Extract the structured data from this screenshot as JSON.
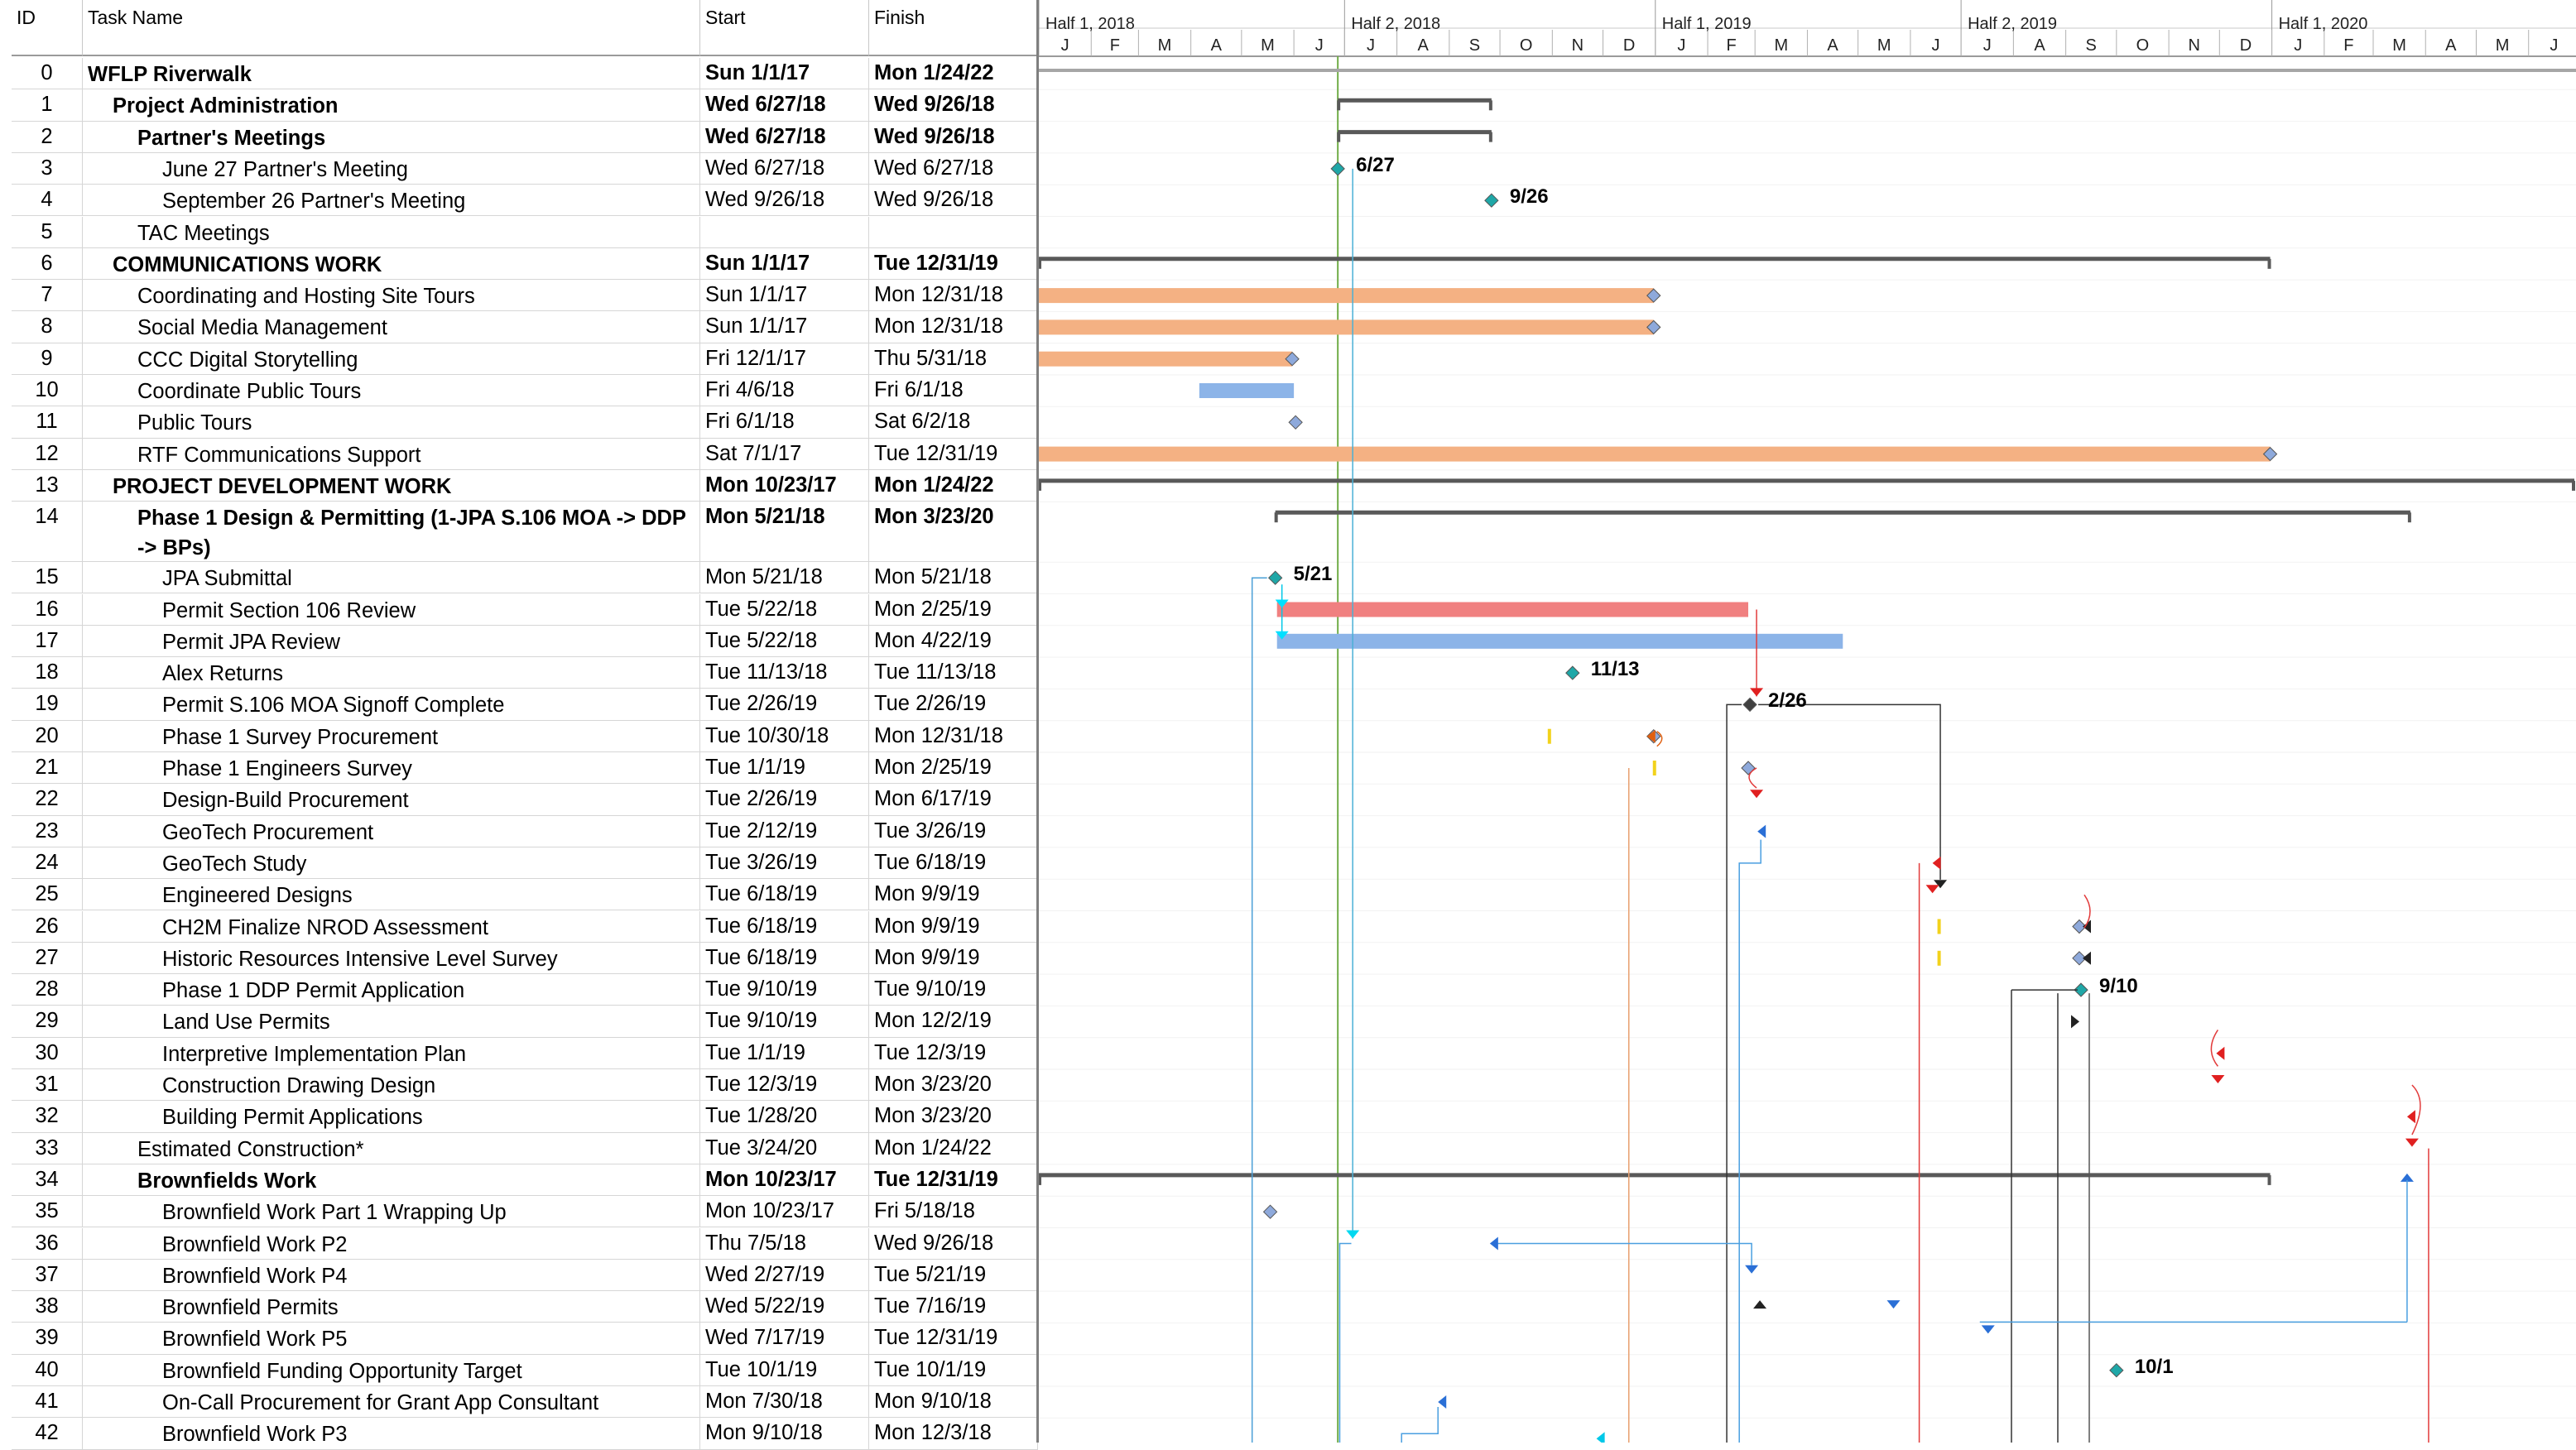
{
  "columns": {
    "id": "ID",
    "name": "Task Name",
    "start": "Start",
    "finish": "Finish"
  },
  "timescale": {
    "halves": [
      "Half 1, 2018",
      "Half 2, 2018",
      "Half 1, 2019",
      "Half 2, 2019",
      "Half 1, 2020"
    ],
    "months": [
      "J",
      "F",
      "M",
      "A",
      "M",
      "J",
      "J",
      "A",
      "S",
      "O",
      "N",
      "D",
      "J",
      "F",
      "M",
      "A",
      "M",
      "J",
      "J",
      "A",
      "S",
      "O",
      "N",
      "D",
      "J",
      "F",
      "M",
      "A",
      "M",
      "J"
    ]
  },
  "tasks": [
    {
      "id": "0",
      "name": "WFLP Riverwalk",
      "start": "Sun 1/1/17",
      "finish": "Mon 1/24/22",
      "bold": true,
      "indent": 0
    },
    {
      "id": "1",
      "name": "Project Administration",
      "start": "Wed 6/27/18",
      "finish": "Wed 9/26/18",
      "bold": true,
      "indent": 1
    },
    {
      "id": "2",
      "name": "Partner's Meetings",
      "start": "Wed 6/27/18",
      "finish": "Wed 9/26/18",
      "bold": true,
      "indent": 2
    },
    {
      "id": "3",
      "name": "June 27 Partner's Meeting",
      "start": "Wed 6/27/18",
      "finish": "Wed 6/27/18",
      "bold": false,
      "indent": 3
    },
    {
      "id": "4",
      "name": "September 26 Partner's Meeting",
      "start": "Wed 9/26/18",
      "finish": "Wed 9/26/18",
      "bold": false,
      "indent": 3
    },
    {
      "id": "5",
      "name": "TAC Meetings",
      "start": "",
      "finish": "",
      "bold": false,
      "indent": 2
    },
    {
      "id": "6",
      "name": "COMMUNICATIONS WORK",
      "start": "Sun 1/1/17",
      "finish": "Tue 12/31/19",
      "bold": true,
      "indent": 1
    },
    {
      "id": "7",
      "name": "Coordinating and Hosting Site Tours",
      "start": "Sun 1/1/17",
      "finish": "Mon 12/31/18",
      "bold": false,
      "indent": 2
    },
    {
      "id": "8",
      "name": "Social Media Management",
      "start": "Sun 1/1/17",
      "finish": "Mon 12/31/18",
      "bold": false,
      "indent": 2
    },
    {
      "id": "9",
      "name": "CCC Digital Storytelling",
      "start": "Fri 12/1/17",
      "finish": "Thu 5/31/18",
      "bold": false,
      "indent": 2
    },
    {
      "id": "10",
      "name": "Coordinate Public Tours",
      "start": "Fri 4/6/18",
      "finish": "Fri 6/1/18",
      "bold": false,
      "indent": 2
    },
    {
      "id": "11",
      "name": "Public Tours",
      "start": "Fri 6/1/18",
      "finish": "Sat 6/2/18",
      "bold": false,
      "indent": 2
    },
    {
      "id": "12",
      "name": "RTF Communications Support",
      "start": "Sat 7/1/17",
      "finish": "Tue 12/31/19",
      "bold": false,
      "indent": 2
    },
    {
      "id": "13",
      "name": "PROJECT DEVELOPMENT WORK",
      "start": "Mon 10/23/17",
      "finish": "Mon 1/24/22",
      "bold": true,
      "indent": 1
    },
    {
      "id": "14",
      "name": "Phase 1 Design & Permitting (1-JPA S.106 MOA -> DDP -> BPs)",
      "start": "Mon 5/21/18",
      "finish": "Mon 3/23/20",
      "bold": true,
      "indent": 2,
      "tall": true
    },
    {
      "id": "15",
      "name": "JPA Submittal",
      "start": "Mon 5/21/18",
      "finish": "Mon 5/21/18",
      "bold": false,
      "indent": 3
    },
    {
      "id": "16",
      "name": "Permit Section 106 Review",
      "start": "Tue 5/22/18",
      "finish": "Mon 2/25/19",
      "bold": false,
      "indent": 3
    },
    {
      "id": "17",
      "name": "Permit JPA Review",
      "start": "Tue 5/22/18",
      "finish": "Mon 4/22/19",
      "bold": false,
      "indent": 3
    },
    {
      "id": "18",
      "name": "Alex Returns",
      "start": "Tue 11/13/18",
      "finish": "Tue 11/13/18",
      "bold": false,
      "indent": 3
    },
    {
      "id": "19",
      "name": "Permit S.106 MOA Signoff Complete",
      "start": "Tue 2/26/19",
      "finish": "Tue 2/26/19",
      "bold": false,
      "indent": 3
    },
    {
      "id": "20",
      "name": "Phase 1 Survey Procurement",
      "start": "Tue 10/30/18",
      "finish": "Mon 12/31/18",
      "bold": false,
      "indent": 3
    },
    {
      "id": "21",
      "name": "Phase 1 Engineers Survey",
      "start": "Tue 1/1/19",
      "finish": "Mon 2/25/19",
      "bold": false,
      "indent": 3
    },
    {
      "id": "22",
      "name": "Design-Build Procurement",
      "start": "Tue 2/26/19",
      "finish": "Mon 6/17/19",
      "bold": false,
      "indent": 3
    },
    {
      "id": "23",
      "name": "GeoTech Procurement",
      "start": "Tue 2/12/19",
      "finish": "Tue 3/26/19",
      "bold": false,
      "indent": 3
    },
    {
      "id": "24",
      "name": "GeoTech Study",
      "start": "Tue 3/26/19",
      "finish": "Tue 6/18/19",
      "bold": false,
      "indent": 3
    },
    {
      "id": "25",
      "name": "Engineered Designs",
      "start": "Tue 6/18/19",
      "finish": "Mon 9/9/19",
      "bold": false,
      "indent": 3
    },
    {
      "id": "26",
      "name": "CH2M Finalize NROD Assessment",
      "start": "Tue 6/18/19",
      "finish": "Mon 9/9/19",
      "bold": false,
      "indent": 3
    },
    {
      "id": "27",
      "name": "Historic Resources Intensive Level Survey",
      "start": "Tue 6/18/19",
      "finish": "Mon 9/9/19",
      "bold": false,
      "indent": 3
    },
    {
      "id": "28",
      "name": "Phase 1 DDP Permit Application",
      "start": "Tue 9/10/19",
      "finish": "Tue 9/10/19",
      "bold": false,
      "indent": 3
    },
    {
      "id": "29",
      "name": "Land Use Permits",
      "start": "Tue 9/10/19",
      "finish": "Mon 12/2/19",
      "bold": false,
      "indent": 3
    },
    {
      "id": "30",
      "name": "Interpretive Implementation Plan",
      "start": "Tue 1/1/19",
      "finish": "Tue 12/3/19",
      "bold": false,
      "indent": 3
    },
    {
      "id": "31",
      "name": "Construction Drawing Design",
      "start": "Tue 12/3/19",
      "finish": "Mon 3/23/20",
      "bold": false,
      "indent": 3
    },
    {
      "id": "32",
      "name": "Building Permit Applications",
      "start": "Tue 1/28/20",
      "finish": "Mon 3/23/20",
      "bold": false,
      "indent": 3
    },
    {
      "id": "33",
      "name": "Estimated Construction*",
      "start": "Tue 3/24/20",
      "finish": "Mon 1/24/22",
      "bold": false,
      "indent": 2
    },
    {
      "id": "34",
      "name": "Brownfields Work",
      "start": "Mon 10/23/17",
      "finish": "Tue 12/31/19",
      "bold": true,
      "indent": 2
    },
    {
      "id": "35",
      "name": "Brownfield Work Part 1 Wrapping Up",
      "start": "Mon 10/23/17",
      "finish": "Fri 5/18/18",
      "bold": false,
      "indent": 3
    },
    {
      "id": "36",
      "name": "Brownfield Work P2",
      "start": "Thu 7/5/18",
      "finish": "Wed 9/26/18",
      "bold": false,
      "indent": 3
    },
    {
      "id": "37",
      "name": "Brownfield Work P4",
      "start": "Wed 2/27/19",
      "finish": "Tue 5/21/19",
      "bold": false,
      "indent": 3
    },
    {
      "id": "38",
      "name": "Brownfield Permits",
      "start": "Wed 5/22/19",
      "finish": "Tue 7/16/19",
      "bold": false,
      "indent": 3
    },
    {
      "id": "39",
      "name": "Brownfield Work P5",
      "start": "Wed 7/17/19",
      "finish": "Tue 12/31/19",
      "bold": false,
      "indent": 3
    },
    {
      "id": "40",
      "name": "Brownfield Funding Opportunity Target",
      "start": "Tue 10/1/19",
      "finish": "Tue 10/1/19",
      "bold": false,
      "indent": 3
    },
    {
      "id": "41",
      "name": "On-Call Procurement for Grant App Consultant",
      "start": "Mon 7/30/18",
      "finish": "Mon 9/10/18",
      "bold": false,
      "indent": 3
    },
    {
      "id": "42",
      "name": "Brownfield Work P3",
      "start": "Mon 9/10/18",
      "finish": "Mon 12/3/18",
      "bold": false,
      "indent": 3
    }
  ],
  "milestone_labels": {
    "t3": "6/27",
    "t4": "9/26",
    "t15": "5/21",
    "t18": "11/13",
    "t19": "2/26",
    "t28": "9/10",
    "t40": "10/1"
  },
  "colors": {
    "summary": "#595959",
    "orange": "#f4b183",
    "blue": "#8cb4e8",
    "red": "#f08080",
    "milestone": "#1fa7a7",
    "diamond_blue": "#8ea9db",
    "today": "#70ad47"
  }
}
